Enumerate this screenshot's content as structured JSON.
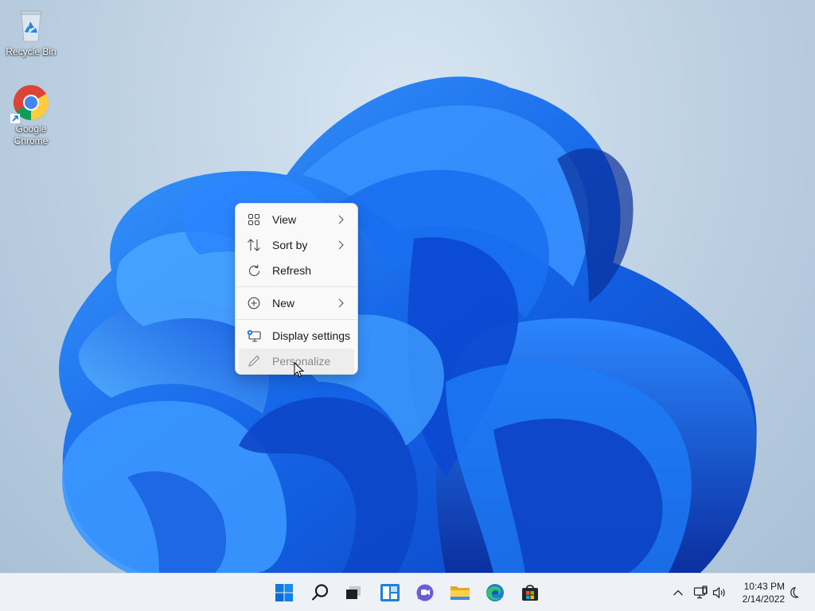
{
  "desktop": {
    "icons": [
      {
        "label": "Recycle Bin",
        "icon": "recycle-bin-icon"
      },
      {
        "label_line1": "Google",
        "label_line2": "Chrome",
        "icon": "chrome-icon"
      }
    ]
  },
  "context_menu": {
    "items": [
      {
        "label": "View",
        "icon": "grid-icon",
        "submenu": true
      },
      {
        "label": "Sort by",
        "icon": "sort-icon",
        "submenu": true
      },
      {
        "label": "Refresh",
        "icon": "refresh-icon",
        "submenu": false
      },
      {
        "label": "New",
        "icon": "plus-circle-icon",
        "submenu": true
      },
      {
        "label": "Display settings",
        "icon": "display-icon",
        "submenu": false
      },
      {
        "label": "Personalize",
        "icon": "pen-icon",
        "submenu": false,
        "state": "hover"
      }
    ]
  },
  "taskbar": {
    "buttons": [
      {
        "icon": "start-icon"
      },
      {
        "icon": "search-icon"
      },
      {
        "icon": "task-view-icon"
      },
      {
        "icon": "widgets-icon"
      },
      {
        "icon": "chat-icon"
      },
      {
        "icon": "file-explorer-icon"
      },
      {
        "icon": "edge-icon"
      },
      {
        "icon": "store-icon"
      }
    ],
    "tray": {
      "icons": [
        "chevron-up-icon",
        "network-icon",
        "volume-icon",
        "moon-icon"
      ],
      "time": "10:43 PM",
      "date": "2/14/2022"
    }
  },
  "colors": {
    "accent": "#0067c0",
    "wallpaper_bloom": "#1a6ff0",
    "taskbar_bg": "#eef2f6"
  }
}
